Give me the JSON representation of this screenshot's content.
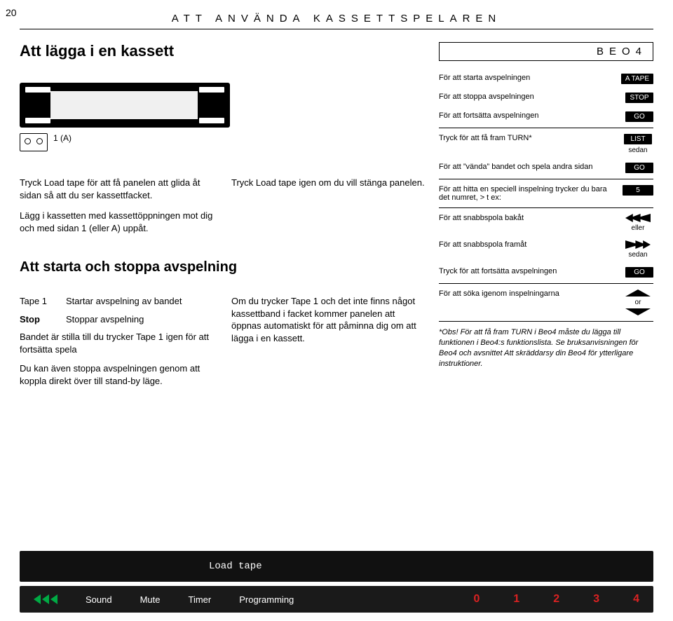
{
  "page_number": "20",
  "section_header": "ATT ANVÄNDA KASSETTSPELAREN",
  "h_insert": "Att lägga i en kassett",
  "cassette_label_text": "1 (A)",
  "left": {
    "p1": "Tryck Load tape  för att få panelen att glida åt sidan så att du ser kassettfacket.",
    "p2": "Lägg i kassetten med kassettöppningen mot dig och med sidan 1 (eller A) uppåt.",
    "p3": "Tryck Load tape igen om du vill stänga panelen."
  },
  "h_startstop": "Att starta och stoppa avspelning",
  "instr": {
    "tape1_lbl": "Tape 1",
    "tape1_desc": "Startar avspelning av bandet",
    "stop_lbl": "Stop",
    "stop_desc": "Stoppar avspelning",
    "p_continue": "Bandet är stilla till du trycker Tape 1 igen för att fortsätta spela",
    "p_standby": "Du kan även stoppa avspelningen genom att koppla direkt över till stand-by läge.",
    "p_notape": "Om du trycker Tape 1 och det inte finns något kassettband i facket kommer panelen att öppnas automatiskt för att påminna dig om att lägga i en kassett."
  },
  "beo4": {
    "header": "BEO4",
    "start_lbl": "För att starta avspelningen",
    "start_chip": "A TAPE",
    "stop_lbl": "För att stoppa avspelningen",
    "stop_chip": "STOP",
    "cont_lbl": "För att fortsätta avspelningen",
    "cont_chip": "GO",
    "turn_lbl": "Tryck för att få fram TURN*",
    "turn_chip": "LIST",
    "turn_sub": "sedan",
    "flip_lbl": "För att ”vända” bandet och spela andra sidan",
    "flip_chip": "GO",
    "find_lbl": "För att hitta en speciell inspelning trycker du bara det numret, > t ex:",
    "find_chip": "5",
    "rew_lbl": "För att snabbspola bakåt",
    "or1": "eller",
    "ffwd_lbl": "För att snabbspola framåt",
    "sedan2": "sedan",
    "cont2_lbl": "Tryck för att fortsätta avspelningen",
    "cont2_chip": "GO",
    "search_lbl": "För att söka igenom inspelningarna",
    "or2": "or",
    "footnote": "*Obs! För att få fram TURN i Beo4 måste du lägga till funktionen i Beo4:s funktionslista. Se bruksanvisningen för Beo4 och avsnittet Att skräddarsy din Beo4 för ytterligare instruktioner."
  },
  "keyboard": {
    "lcd": "Load tape",
    "menus": [
      "Sound",
      "Mute",
      "Timer",
      "Programming"
    ],
    "nums": [
      "0",
      "1",
      "2",
      "3",
      "4"
    ]
  }
}
